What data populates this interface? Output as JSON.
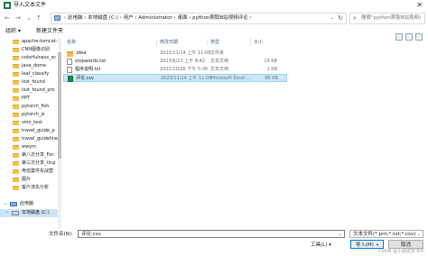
{
  "window": {
    "title": "导入文本文件",
    "close_glyph": "✕"
  },
  "nav_buttons": {
    "back": "←",
    "forward": "→",
    "down": "⌄",
    "up": "↑"
  },
  "address": {
    "crumbs": "›  此电脑  ›  本地磁盘 (C:)  ›  用户  ›  Administrator  ›  桌面  ›  python爬取B站视频评论  ›",
    "dropdown": "⌄",
    "refresh": "↻"
  },
  "search": {
    "placeholder": "搜索\"python爬取B站视频评论\"",
    "icon": "search-icon"
  },
  "toolbar": {
    "organize": "组织 ▾",
    "new_folder": "新建文件夹"
  },
  "sidebar": {
    "folders": [
      "apache-tomcat-",
      "CNN图像识别",
      "colorfulness_sc",
      "java_dome",
      "leaf_classify",
      "lost_found",
      "lost_found_pro",
      "PPT",
      "pytorch_fish",
      "pytorch_js",
      "smo_test",
      "travel_guide_p",
      "travel_guideline",
      "wwym",
      "第八次分享_Foc",
      "第三次分享_Unp",
      "电信案件实战营",
      "图片",
      "客户流失分析"
    ],
    "this_pc": "此电脑",
    "drive": "本地磁盘 (C:)"
  },
  "columns": {
    "name": "名称",
    "date": "修改日期",
    "type": "类型",
    "size": "大小"
  },
  "files": [
    {
      "name": ".idea",
      "date": "2023/11/14 上午 11:08",
      "type": "文件夹",
      "size": "",
      "icon": "folder"
    },
    {
      "name": "stopwords.txt",
      "date": "2023/6/22 上午 8:42",
      "type": "文本文档",
      "size": "19 KB",
      "icon": "txt"
    },
    {
      "name": "程序说明.txt",
      "date": "2022/10/26 下午 5:06",
      "type": "文本文档",
      "size": "1 KB",
      "icon": "txt"
    },
    {
      "name": "评论.csv",
      "date": "2023/11/14 上午 11:09",
      "type": "Microsoft Excel ...",
      "size": "66 KB",
      "icon": "csv"
    }
  ],
  "bottom": {
    "filename_label": "文件名(N):",
    "filename_value": "评论.csv",
    "filter": "文本文件(*.prn;*.txt;*.csv)",
    "tools": "工具(L) ▾",
    "open": "导入(M)",
    "cancel": "取消"
  },
  "watermark": "CSDN @小胡说技书中"
}
